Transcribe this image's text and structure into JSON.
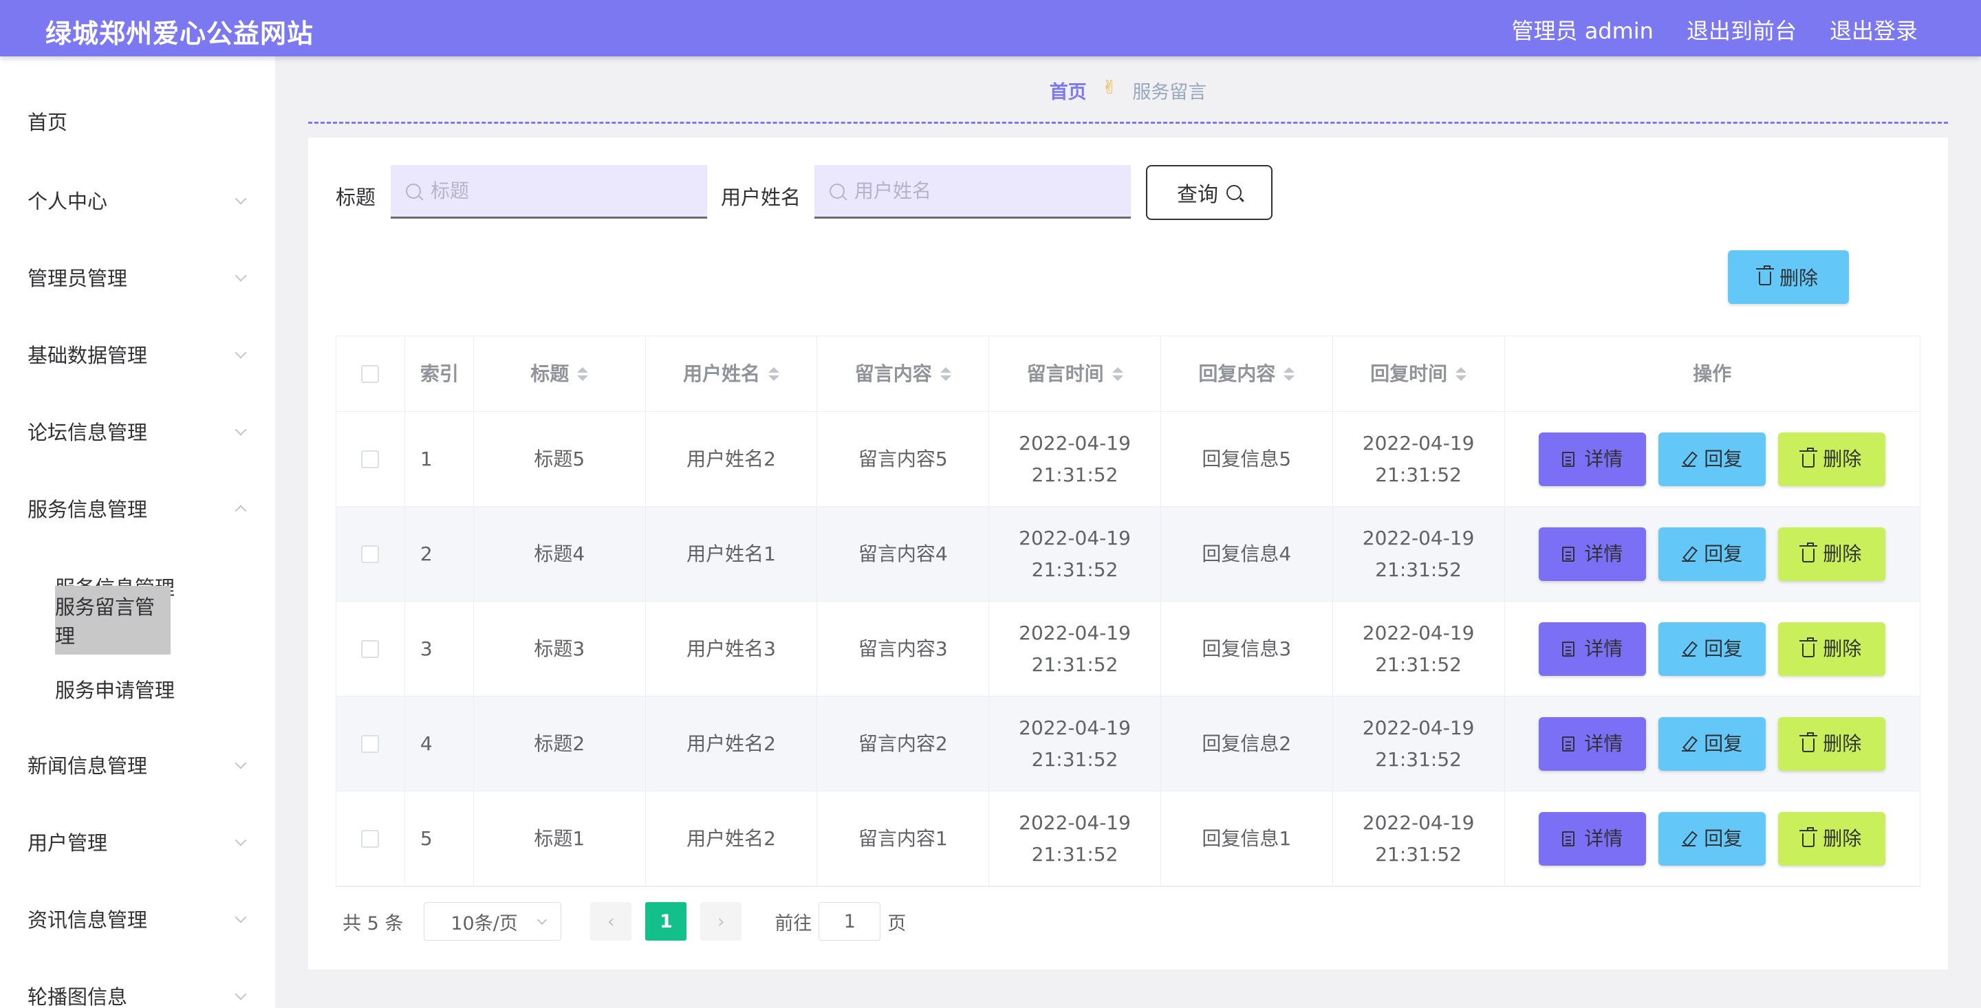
{
  "header": {
    "title": "绿城郑州爱心公益网站",
    "admin_label": "管理员 admin",
    "exit_front": "退出到前台",
    "logout": "退出登录"
  },
  "sidebar": {
    "items": [
      {
        "label": "首页"
      },
      {
        "label": "个人中心"
      },
      {
        "label": "管理员管理"
      },
      {
        "label": "基础数据管理"
      },
      {
        "label": "论坛信息管理"
      },
      {
        "label": "服务信息管理"
      },
      {
        "label": "新闻信息管理"
      },
      {
        "label": "用户管理"
      },
      {
        "label": "资讯信息管理"
      },
      {
        "label": "轮播图信息"
      }
    ],
    "subitems": [
      {
        "label": "服务信息管理"
      },
      {
        "label": "服务留言管理"
      },
      {
        "label": "服务申请管理"
      }
    ]
  },
  "breadcrumb": {
    "home": "首页",
    "separator": "✌",
    "current": "服务留言"
  },
  "search": {
    "title_label": "标题",
    "title_placeholder": "标题",
    "user_label": "用户姓名",
    "user_placeholder": "用户姓名",
    "query_button": "查询"
  },
  "toolbar": {
    "delete_label": "删除"
  },
  "table": {
    "headers": [
      "索引",
      "标题",
      "用户姓名",
      "留言内容",
      "留言时间",
      "回复内容",
      "回复时间",
      "操作"
    ],
    "rows": [
      {
        "index": "1",
        "title": "标题5",
        "user": "用户姓名2",
        "content": "留言内容5",
        "time": "2022-04-19 21:31:52",
        "reply": "回复信息5",
        "reply_time": "2022-04-19 21:31:52"
      },
      {
        "index": "2",
        "title": "标题4",
        "user": "用户姓名1",
        "content": "留言内容4",
        "time": "2022-04-19 21:31:52",
        "reply": "回复信息4",
        "reply_time": "2022-04-19 21:31:52"
      },
      {
        "index": "3",
        "title": "标题3",
        "user": "用户姓名3",
        "content": "留言内容3",
        "time": "2022-04-19 21:31:52",
        "reply": "回复信息3",
        "reply_time": "2022-04-19 21:31:52"
      },
      {
        "index": "4",
        "title": "标题2",
        "user": "用户姓名2",
        "content": "留言内容2",
        "time": "2022-04-19 21:31:52",
        "reply": "回复信息2",
        "reply_time": "2022-04-19 21:31:52"
      },
      {
        "index": "5",
        "title": "标题1",
        "user": "用户姓名2",
        "content": "留言内容1",
        "time": "2022-04-19 21:31:52",
        "reply": "回复信息1",
        "reply_time": "2022-04-19 21:31:52"
      }
    ],
    "actions": {
      "detail": "详情",
      "reply": "回复",
      "delete": "删除"
    }
  },
  "pagination": {
    "total": "共 5 条",
    "page_size": "10条/页",
    "current_page": "1",
    "goto_label": "前往",
    "goto_value": "1",
    "page_suffix": "页"
  },
  "colors": {
    "header_bg": "#7b78f2",
    "detail_btn": "#7b70f5",
    "reply_btn": "#63c8f8",
    "delete_btn": "#c9f05a",
    "page_active": "#13c08a"
  }
}
